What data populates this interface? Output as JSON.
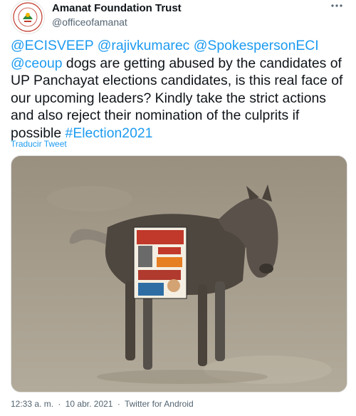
{
  "header": {
    "display_name": "Amanat Foundation Trust",
    "handle": "@officeofamanat",
    "avatar_icon": "foundation-logo",
    "more_icon": "more-options-icon"
  },
  "tweet": {
    "mentions": [
      "@ECISVEEP",
      "@rajivkumarec",
      "@SpokespersonECI",
      "@ceoup"
    ],
    "body": " dogs are getting abused by the candidates of UP Panchayat elections candidates, is this real face of our upcoming leaders? Kindly take the strict actions and also reject their nomination of the culprits if possible ",
    "hashtag": "#Election2021",
    "translate_label": "Traducir Tweet"
  },
  "media": {
    "description_icon": "dog-with-poster-photo"
  },
  "meta": {
    "time": "12:33 a. m.",
    "separator": "·",
    "date": "10 abr. 2021",
    "source": "Twitter for Android"
  },
  "colors": {
    "link": "#1d9bf0",
    "secondary_text": "#536471"
  }
}
